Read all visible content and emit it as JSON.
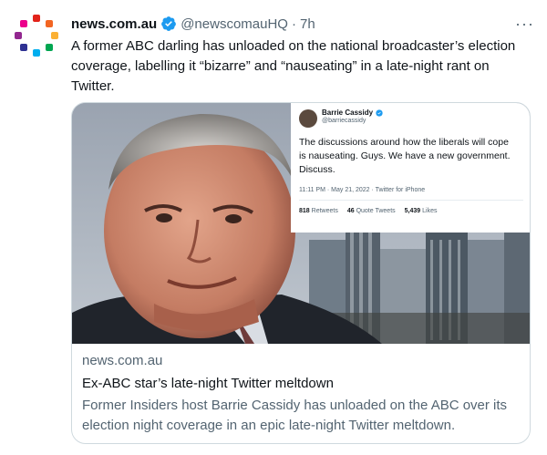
{
  "tweet": {
    "author_name": "news.com.au",
    "handle": "@newscomauHQ",
    "separator": "·",
    "time": "7h",
    "more_label": "···",
    "text": "A former ABC darling has unloaded on the national broadcaster’s election coverage, labelling it “bizarre” and “nauseating” in a late-night rant on Twitter.",
    "verified_icon": "verified-badge-icon",
    "colors": {
      "verified": "#1d9bf0",
      "muted": "#536471",
      "text": "#0f1419"
    }
  },
  "card": {
    "domain": "news.com.au",
    "title": "Ex-ABC star’s late-night Twitter meltdown",
    "description": "Former Insiders host Barrie Cassidy has unloaded on the ABC over its election night coverage in an epic late-night Twitter meltdown.",
    "inset": {
      "name": "Barrie Cassidy",
      "handle": "@barriecassidy",
      "text": "The discussions around how the liberals will cope is nauseating. Guys. We have a new government. Discuss.",
      "timestamp": "11:11 PM · May 21, 2022 · Twitter for iPhone",
      "retweets_count": "818",
      "retweets_label": "Retweets",
      "quotes_count": "46",
      "quotes_label": "Quote Tweets",
      "likes_count": "5,439",
      "likes_label": "Likes"
    }
  }
}
